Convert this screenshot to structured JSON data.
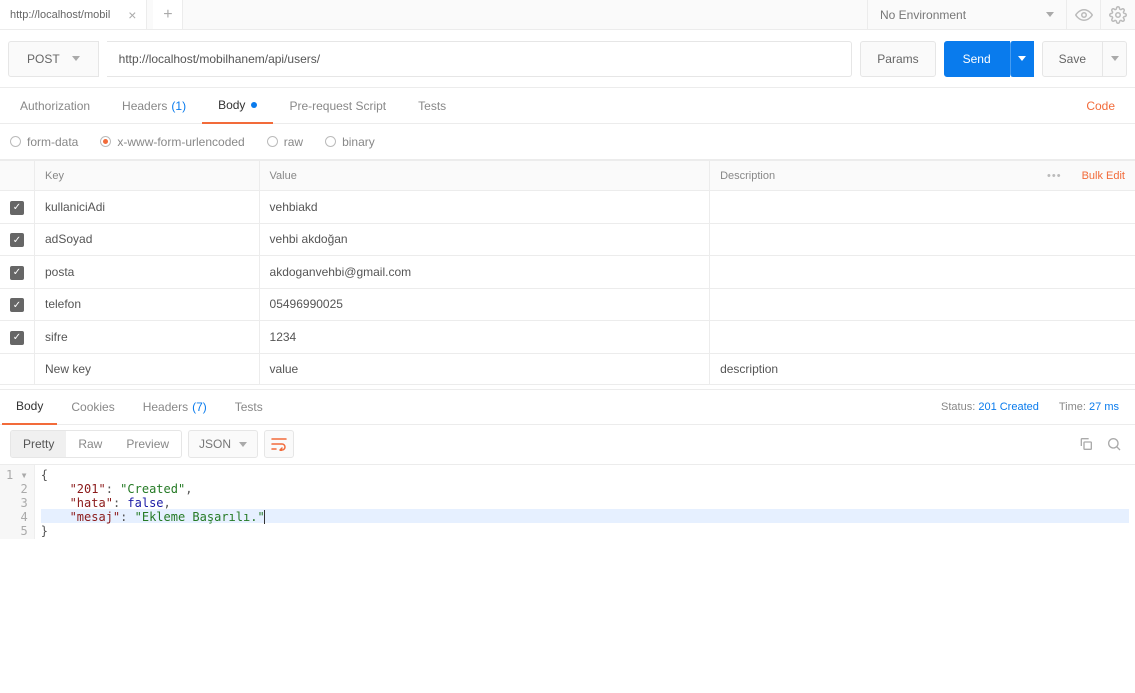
{
  "topbar": {
    "tab_title": "http://localhost/mobil",
    "environment": "No Environment"
  },
  "request": {
    "method": "POST",
    "url": "http://localhost/mobilhanem/api/users/",
    "params_btn": "Params",
    "send_btn": "Send",
    "save_btn": "Save"
  },
  "req_tabs": {
    "authorization": "Authorization",
    "headers": "Headers",
    "headers_count": "(1)",
    "body": "Body",
    "prerequest": "Pre-request Script",
    "tests": "Tests",
    "code": "Code"
  },
  "body_types": {
    "formdata": "form-data",
    "urlencoded": "x-www-form-urlencoded",
    "raw": "raw",
    "binary": "binary"
  },
  "kv": {
    "headers": {
      "key": "Key",
      "value": "Value",
      "description": "Description"
    },
    "bulk_edit": "Bulk Edit",
    "rows": [
      {
        "key": "kullaniciAdi",
        "value": "vehbiakd"
      },
      {
        "key": "adSoyad",
        "value": "vehbi akdoğan"
      },
      {
        "key": "posta",
        "value": "akdoganvehbi@gmail.com"
      },
      {
        "key": "telefon",
        "value": "05496990025"
      },
      {
        "key": "sifre",
        "value": "1234"
      }
    ],
    "placeholders": {
      "key": "New key",
      "value": "value",
      "description": "description"
    }
  },
  "resp_tabs": {
    "body": "Body",
    "cookies": "Cookies",
    "headers": "Headers",
    "headers_count": "(7)",
    "tests": "Tests"
  },
  "resp_status": {
    "status_label": "Status:",
    "status_value": "201 Created",
    "time_label": "Time:",
    "time_value": "27 ms"
  },
  "resp_toolbar": {
    "pretty": "Pretty",
    "raw": "Raw",
    "preview": "Preview",
    "format": "JSON"
  },
  "response_json": {
    "l1": "{",
    "l2a": "    \"201\"",
    "l2b": ": ",
    "l2c": "\"Created\"",
    "l2d": ",",
    "l3a": "    \"hata\"",
    "l3b": ": ",
    "l3c": "false",
    "l3d": ",",
    "l4a": "    \"mesaj\"",
    "l4b": ": ",
    "l4c": "\"Ekleme Başarılı.\"",
    "l5": "}"
  }
}
